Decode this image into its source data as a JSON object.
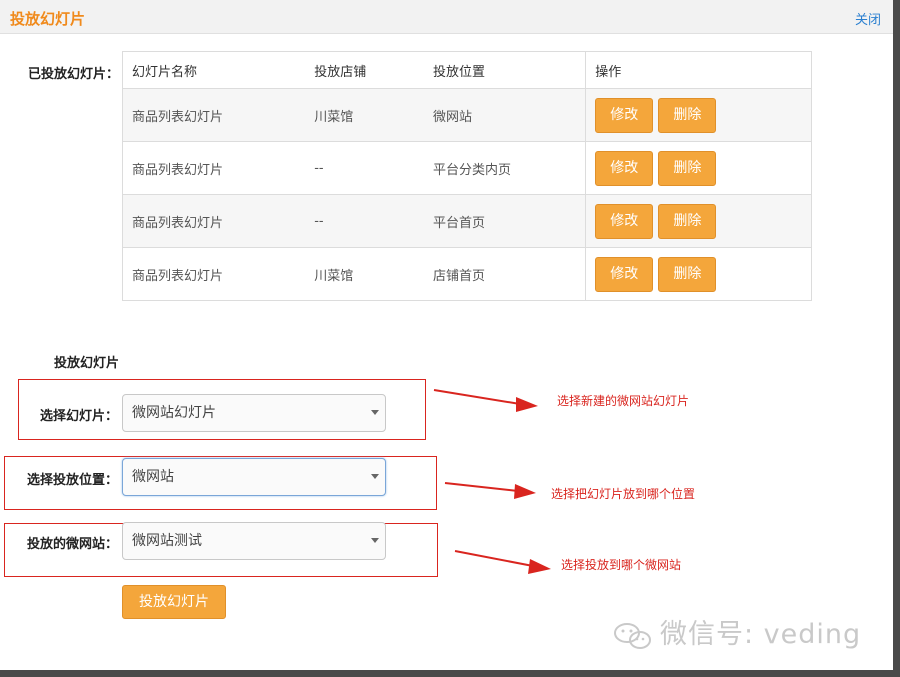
{
  "dialog": {
    "title": "投放幻灯片",
    "close_label": "关闭"
  },
  "placed": {
    "label": "已投放幻灯片：",
    "columns": [
      "幻灯片名称",
      "投放店铺",
      "投放位置",
      "操作"
    ],
    "rows": [
      {
        "name": "商品列表幻灯片",
        "store": "川菜馆",
        "position": "微网站",
        "edit": "修改",
        "delete": "删除"
      },
      {
        "name": "商品列表幻灯片",
        "store": "--",
        "position": "平台分类内页",
        "edit": "修改",
        "delete": "删除"
      },
      {
        "name": "商品列表幻灯片",
        "store": "--",
        "position": "平台首页",
        "edit": "修改",
        "delete": "删除"
      },
      {
        "name": "商品列表幻灯片",
        "store": "川菜馆",
        "position": "店铺首页",
        "edit": "修改",
        "delete": "删除"
      }
    ]
  },
  "form": {
    "heading": "投放幻灯片",
    "slide": {
      "label": "选择幻灯片：",
      "value": "微网站幻灯片"
    },
    "position": {
      "label": "选择投放位置：",
      "value": "微网站"
    },
    "site": {
      "label": "投放的微网站：",
      "value": "微网站测试"
    },
    "submit_label": "投放幻灯片"
  },
  "annotations": {
    "color": "#d9251f",
    "note1": "选择新建的微网站幻灯片",
    "note2": "选择把幻灯片放到哪个位置",
    "note3": "选择投放到哪个微网站"
  },
  "watermark": {
    "text": "微信号: veding",
    "icon": "wechat-icon"
  },
  "colors": {
    "accent": "#f4a63b",
    "title": "#f08a1c",
    "link": "#2a7fd0"
  }
}
